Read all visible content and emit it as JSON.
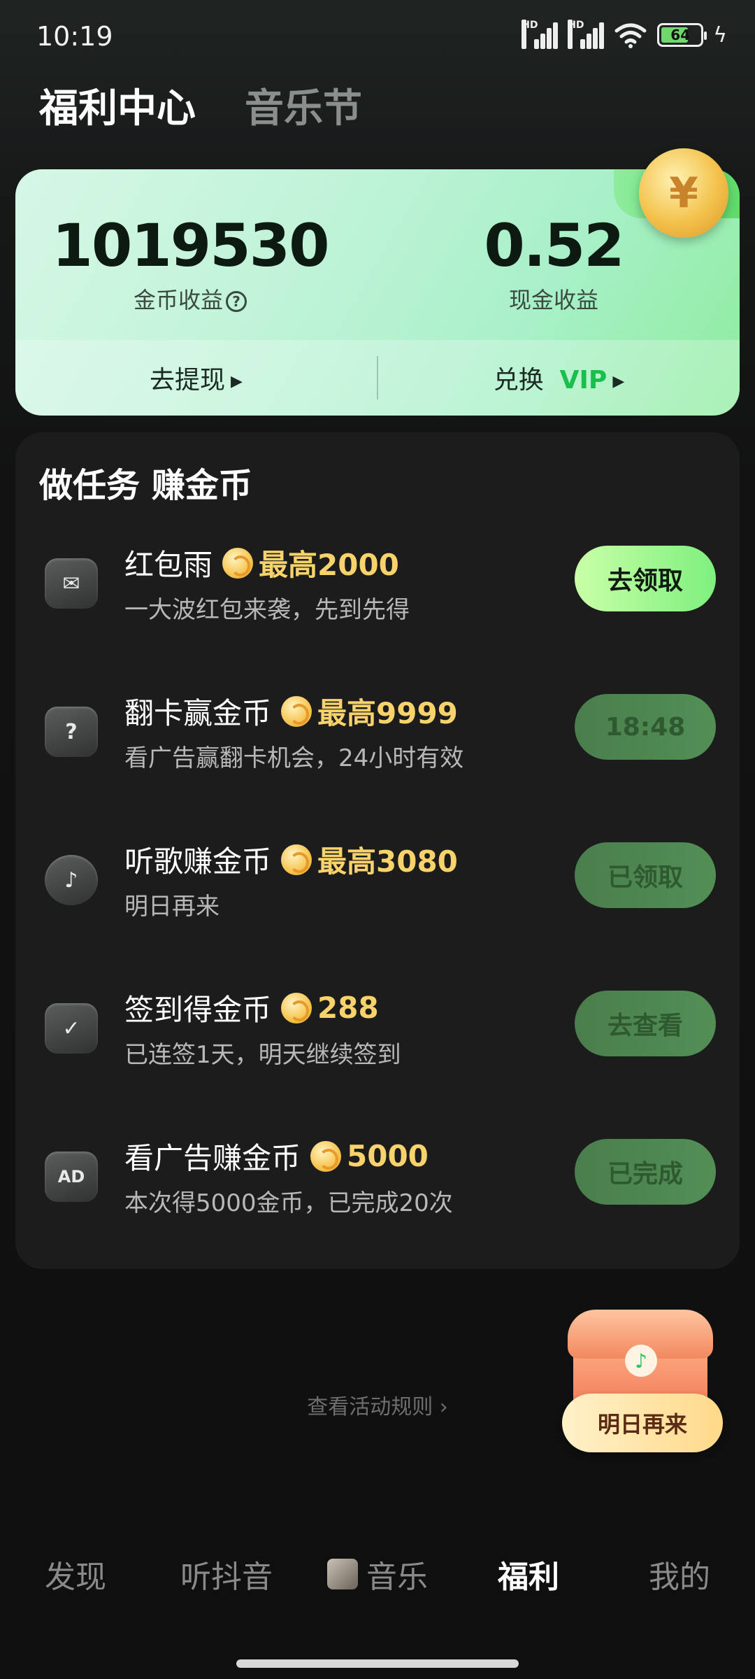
{
  "status_bar": {
    "time": "10:19",
    "battery": "64",
    "signal_label": "HD"
  },
  "header": {
    "tabs": [
      {
        "label": "福利中心"
      },
      {
        "label": "音乐节"
      }
    ]
  },
  "earnings": {
    "coins_value": "1019530",
    "coins_label": "金币收益",
    "cash_value": "0.52",
    "cash_label": "现金收益",
    "withdraw_label": "去提现",
    "exchange_label": "兑换",
    "vip_label": "VIP"
  },
  "tasks": {
    "title": "做任务 赚金币",
    "items": [
      {
        "name": "红包雨",
        "reward": "最高2000",
        "desc": "一大波红包来袭，先到先得",
        "button": "去领取",
        "icon": "red-envelope-icon"
      },
      {
        "name": "翻卡赢金币",
        "reward": "最高9999",
        "desc": "看广告赢翻卡机会，24小时有效",
        "button": "18:48",
        "icon": "card-question-icon"
      },
      {
        "name": "听歌赚金币",
        "reward": "最高3080",
        "desc": "明日再来",
        "button": "已领取",
        "icon": "music-note-icon"
      },
      {
        "name": "签到得金币",
        "reward": "288",
        "desc": "已连签1天，明天继续签到",
        "button": "去查看",
        "icon": "calendar-check-icon"
      },
      {
        "name": "看广告赚金币",
        "reward": "5000",
        "desc": "本次得5000金币，已完成20次",
        "button": "已完成",
        "icon": "ad-icon"
      }
    ]
  },
  "rules_link": "查看活动规则 ›",
  "chest": {
    "label": "明日再来"
  },
  "bottom_nav": {
    "items": [
      {
        "label": "发现"
      },
      {
        "label": "听抖音"
      },
      {
        "label": "音乐"
      },
      {
        "label": "福利"
      },
      {
        "label": "我的"
      }
    ]
  },
  "colors": {
    "accent_green": "#7ef07e",
    "reward_gold": "#f8d36b",
    "vip_green": "#1bbd4f"
  }
}
